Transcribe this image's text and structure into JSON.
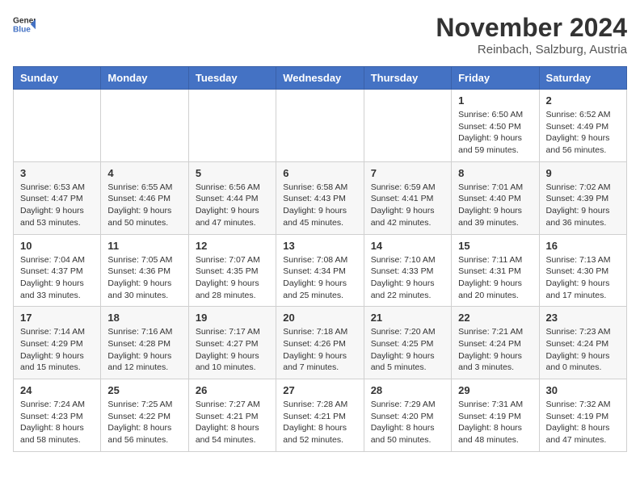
{
  "header": {
    "logo_general": "General",
    "logo_blue": "Blue",
    "title": "November 2024",
    "subtitle": "Reinbach, Salzburg, Austria"
  },
  "columns": [
    "Sunday",
    "Monday",
    "Tuesday",
    "Wednesday",
    "Thursday",
    "Friday",
    "Saturday"
  ],
  "weeks": [
    {
      "row_class": "row-white",
      "days": [
        {
          "date": "",
          "empty": true
        },
        {
          "date": "",
          "empty": true
        },
        {
          "date": "",
          "empty": true
        },
        {
          "date": "",
          "empty": true
        },
        {
          "date": "",
          "empty": true
        },
        {
          "date": "1",
          "sunrise": "Sunrise: 6:50 AM",
          "sunset": "Sunset: 4:50 PM",
          "daylight": "Daylight: 9 hours and 59 minutes."
        },
        {
          "date": "2",
          "sunrise": "Sunrise: 6:52 AM",
          "sunset": "Sunset: 4:49 PM",
          "daylight": "Daylight: 9 hours and 56 minutes."
        }
      ]
    },
    {
      "row_class": "row-gray",
      "days": [
        {
          "date": "3",
          "sunrise": "Sunrise: 6:53 AM",
          "sunset": "Sunset: 4:47 PM",
          "daylight": "Daylight: 9 hours and 53 minutes."
        },
        {
          "date": "4",
          "sunrise": "Sunrise: 6:55 AM",
          "sunset": "Sunset: 4:46 PM",
          "daylight": "Daylight: 9 hours and 50 minutes."
        },
        {
          "date": "5",
          "sunrise": "Sunrise: 6:56 AM",
          "sunset": "Sunset: 4:44 PM",
          "daylight": "Daylight: 9 hours and 47 minutes."
        },
        {
          "date": "6",
          "sunrise": "Sunrise: 6:58 AM",
          "sunset": "Sunset: 4:43 PM",
          "daylight": "Daylight: 9 hours and 45 minutes."
        },
        {
          "date": "7",
          "sunrise": "Sunrise: 6:59 AM",
          "sunset": "Sunset: 4:41 PM",
          "daylight": "Daylight: 9 hours and 42 minutes."
        },
        {
          "date": "8",
          "sunrise": "Sunrise: 7:01 AM",
          "sunset": "Sunset: 4:40 PM",
          "daylight": "Daylight: 9 hours and 39 minutes."
        },
        {
          "date": "9",
          "sunrise": "Sunrise: 7:02 AM",
          "sunset": "Sunset: 4:39 PM",
          "daylight": "Daylight: 9 hours and 36 minutes."
        }
      ]
    },
    {
      "row_class": "row-white",
      "days": [
        {
          "date": "10",
          "sunrise": "Sunrise: 7:04 AM",
          "sunset": "Sunset: 4:37 PM",
          "daylight": "Daylight: 9 hours and 33 minutes."
        },
        {
          "date": "11",
          "sunrise": "Sunrise: 7:05 AM",
          "sunset": "Sunset: 4:36 PM",
          "daylight": "Daylight: 9 hours and 30 minutes."
        },
        {
          "date": "12",
          "sunrise": "Sunrise: 7:07 AM",
          "sunset": "Sunset: 4:35 PM",
          "daylight": "Daylight: 9 hours and 28 minutes."
        },
        {
          "date": "13",
          "sunrise": "Sunrise: 7:08 AM",
          "sunset": "Sunset: 4:34 PM",
          "daylight": "Daylight: 9 hours and 25 minutes."
        },
        {
          "date": "14",
          "sunrise": "Sunrise: 7:10 AM",
          "sunset": "Sunset: 4:33 PM",
          "daylight": "Daylight: 9 hours and 22 minutes."
        },
        {
          "date": "15",
          "sunrise": "Sunrise: 7:11 AM",
          "sunset": "Sunset: 4:31 PM",
          "daylight": "Daylight: 9 hours and 20 minutes."
        },
        {
          "date": "16",
          "sunrise": "Sunrise: 7:13 AM",
          "sunset": "Sunset: 4:30 PM",
          "daylight": "Daylight: 9 hours and 17 minutes."
        }
      ]
    },
    {
      "row_class": "row-gray",
      "days": [
        {
          "date": "17",
          "sunrise": "Sunrise: 7:14 AM",
          "sunset": "Sunset: 4:29 PM",
          "daylight": "Daylight: 9 hours and 15 minutes."
        },
        {
          "date": "18",
          "sunrise": "Sunrise: 7:16 AM",
          "sunset": "Sunset: 4:28 PM",
          "daylight": "Daylight: 9 hours and 12 minutes."
        },
        {
          "date": "19",
          "sunrise": "Sunrise: 7:17 AM",
          "sunset": "Sunset: 4:27 PM",
          "daylight": "Daylight: 9 hours and 10 minutes."
        },
        {
          "date": "20",
          "sunrise": "Sunrise: 7:18 AM",
          "sunset": "Sunset: 4:26 PM",
          "daylight": "Daylight: 9 hours and 7 minutes."
        },
        {
          "date": "21",
          "sunrise": "Sunrise: 7:20 AM",
          "sunset": "Sunset: 4:25 PM",
          "daylight": "Daylight: 9 hours and 5 minutes."
        },
        {
          "date": "22",
          "sunrise": "Sunrise: 7:21 AM",
          "sunset": "Sunset: 4:24 PM",
          "daylight": "Daylight: 9 hours and 3 minutes."
        },
        {
          "date": "23",
          "sunrise": "Sunrise: 7:23 AM",
          "sunset": "Sunset: 4:24 PM",
          "daylight": "Daylight: 9 hours and 0 minutes."
        }
      ]
    },
    {
      "row_class": "row-white",
      "days": [
        {
          "date": "24",
          "sunrise": "Sunrise: 7:24 AM",
          "sunset": "Sunset: 4:23 PM",
          "daylight": "Daylight: 8 hours and 58 minutes."
        },
        {
          "date": "25",
          "sunrise": "Sunrise: 7:25 AM",
          "sunset": "Sunset: 4:22 PM",
          "daylight": "Daylight: 8 hours and 56 minutes."
        },
        {
          "date": "26",
          "sunrise": "Sunrise: 7:27 AM",
          "sunset": "Sunset: 4:21 PM",
          "daylight": "Daylight: 8 hours and 54 minutes."
        },
        {
          "date": "27",
          "sunrise": "Sunrise: 7:28 AM",
          "sunset": "Sunset: 4:21 PM",
          "daylight": "Daylight: 8 hours and 52 minutes."
        },
        {
          "date": "28",
          "sunrise": "Sunrise: 7:29 AM",
          "sunset": "Sunset: 4:20 PM",
          "daylight": "Daylight: 8 hours and 50 minutes."
        },
        {
          "date": "29",
          "sunrise": "Sunrise: 7:31 AM",
          "sunset": "Sunset: 4:19 PM",
          "daylight": "Daylight: 8 hours and 48 minutes."
        },
        {
          "date": "30",
          "sunrise": "Sunrise: 7:32 AM",
          "sunset": "Sunset: 4:19 PM",
          "daylight": "Daylight: 8 hours and 47 minutes."
        }
      ]
    }
  ]
}
